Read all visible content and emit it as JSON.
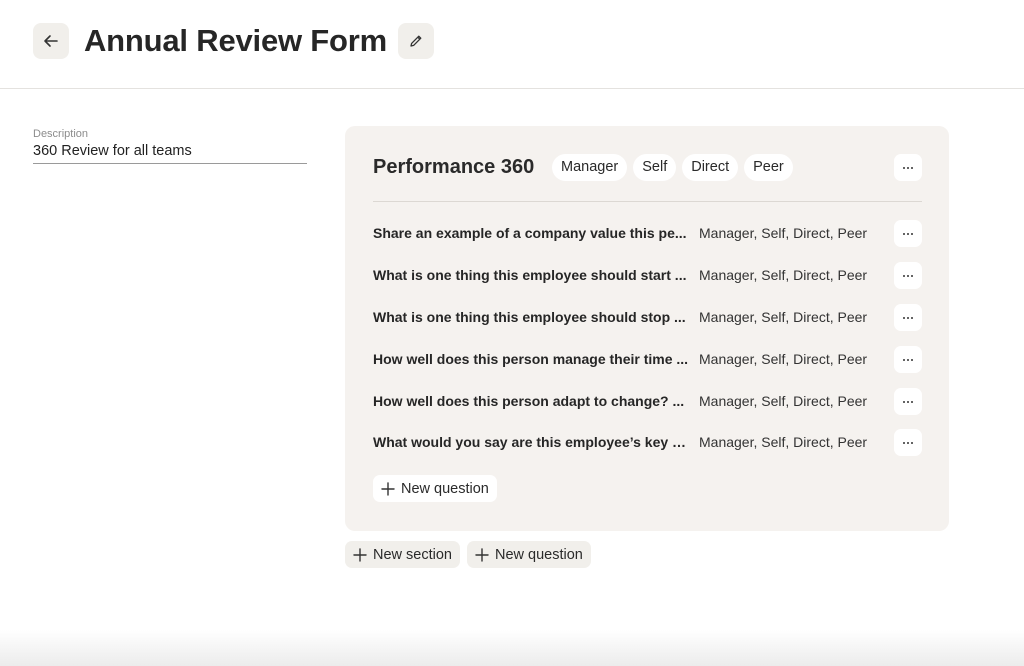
{
  "header": {
    "title": "Annual Review Form",
    "back_icon": "arrow-left-icon",
    "edit_icon": "pencil-icon"
  },
  "description": {
    "label": "Description",
    "value": "360 Review for all teams"
  },
  "section": {
    "title": "Performance 360",
    "tags": [
      "Manager",
      "Self",
      "Direct",
      "Peer"
    ],
    "more_label": "···",
    "questions": [
      {
        "text": "Share an example of a company value this pe...",
        "audience": "Manager, Self, Direct, Peer"
      },
      {
        "text": "What is one thing this employee should start ...",
        "audience": "Manager, Self, Direct, Peer"
      },
      {
        "text": "What is one thing this employee should stop ...",
        "audience": "Manager, Self, Direct, Peer"
      },
      {
        "text": "How well does this person manage their time ...",
        "audience": "Manager, Self, Direct, Peer"
      },
      {
        "text": "How well does this person adapt to change? ...",
        "audience": "Manager, Self, Direct, Peer"
      },
      {
        "text": "What would you say are this employee’s key s...",
        "audience": "Manager, Self, Direct, Peer"
      }
    ],
    "new_question_label": "New question"
  },
  "footer_actions": {
    "new_section_label": "New section",
    "new_question_label": "New question"
  },
  "colors": {
    "card_bg": "#f5f2ef",
    "button_bg": "#f1efeb",
    "text": "#262626"
  }
}
